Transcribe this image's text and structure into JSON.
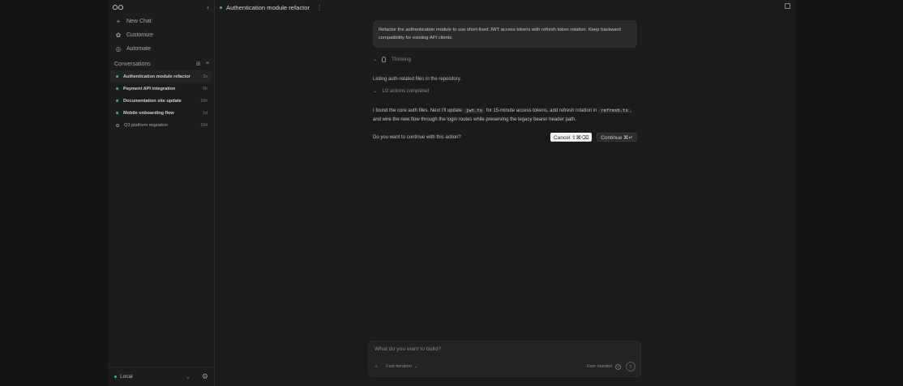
{
  "sidebar": {
    "nav": [
      {
        "icon": "+",
        "label": "New Chat"
      },
      {
        "icon": "✿",
        "label": "Customize"
      },
      {
        "icon": "◎",
        "label": "Automate"
      }
    ],
    "section_label": "Conversations",
    "conversations": [
      {
        "title": "Authentication module refactor",
        "age": "2s",
        "status": "active"
      },
      {
        "title": "Payment API integration",
        "age": "6h",
        "status": "active"
      },
      {
        "title": "Documentation site update",
        "age": "16h",
        "status": "active"
      },
      {
        "title": "Mobile onboarding flow",
        "age": "1d",
        "status": "active"
      },
      {
        "title": "Q3 platform migration",
        "age": "10d",
        "status": "idle"
      }
    ],
    "footer": {
      "env_label": "Local"
    }
  },
  "main": {
    "title": "Authentication module refactor",
    "user_message": "Refactor the authentication module to use short-lived JWT access tokens with refresh token rotation. Keep backward compatibility for existing API clients.",
    "thinking_label": "Thinking",
    "status_line": "Listing auth-related files in the repository.",
    "actions_label": "1/2 actions completed",
    "reply": {
      "p1": "I found the core auth files. Next I'll update",
      "code1": "jwt.ts",
      "p2": "for 15-minute access tokens, add refresh rotation in",
      "code2": "refresh.ts",
      "p3": ", and wire the new flow through the login routes while preserving the legacy bearer header path."
    },
    "confirm": {
      "question": "Do you want to continue with this action?",
      "cancel_label": "Cancel ⇧⌘⌫",
      "continue_label": "Continue ⌘↵"
    }
  },
  "composer": {
    "placeholder": "What do you want to build?",
    "mode_label": "Fast iteration",
    "user_needed_label": "User needed",
    "help_glyph": "?"
  },
  "colors": {
    "accent_green": "#3fbf6a",
    "background": "#1b1b1b",
    "bubble": "#2b2b2b"
  }
}
